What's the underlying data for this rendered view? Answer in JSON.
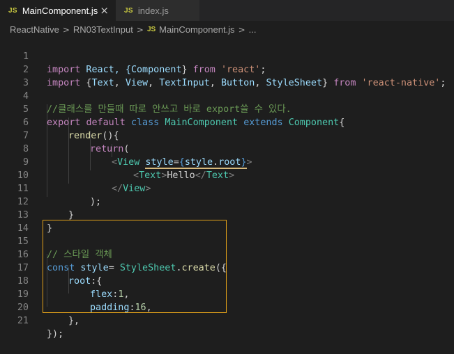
{
  "tabs": [
    {
      "label": "MainComponent.js",
      "badge": "JS",
      "close": "×"
    },
    {
      "label": "index.js",
      "badge": "JS"
    }
  ],
  "breadcrumb": {
    "items": [
      "ReactNative",
      "RN03TextInput",
      "MainComponent.js",
      "..."
    ],
    "js_badge": "JS"
  },
  "line_numbers": [
    "1",
    "2",
    "3",
    "4",
    "5",
    "6",
    "7",
    "8",
    "9",
    "10",
    "11",
    "12",
    "13",
    "14",
    "15",
    "16",
    "17",
    "18",
    "19",
    "20",
    "21"
  ],
  "code": {
    "l1": [
      "import",
      " React, {",
      "Component",
      "} ",
      "from",
      " ",
      "'react'",
      ";"
    ],
    "l2": [
      "import",
      " {",
      "Text",
      ", ",
      "View",
      ", ",
      "TextInput",
      ", ",
      "Button",
      ", ",
      "StyleSheet",
      "} ",
      "from",
      " ",
      "'react-native'",
      ";"
    ],
    "l4": "//클래스를 만들때 따로 안쓰고 바로 export쓸 수 있다.",
    "l5": [
      "export",
      " ",
      "default",
      " ",
      "class",
      " ",
      "MainComponent",
      " ",
      "extends",
      " ",
      "Component",
      "{"
    ],
    "l6": [
      "render",
      "(){"
    ],
    "l7": [
      "return",
      "("
    ],
    "l8": [
      "<",
      "View",
      " ",
      "style",
      "=",
      "{",
      "style",
      ".",
      "root",
      "}",
      ">"
    ],
    "l9": [
      "<",
      "Text",
      ">",
      "Hello",
      "</",
      "Text",
      ">"
    ],
    "l10": [
      "</",
      "View",
      ">"
    ],
    "l11": ");",
    "l12": "}",
    "l13": "}",
    "l15": "// 스타일 객체",
    "l16": [
      "const",
      " ",
      "style",
      "= ",
      "StyleSheet",
      ".",
      "create",
      "({"
    ],
    "l17": [
      "root",
      ":{"
    ],
    "l18": [
      "flex",
      ":",
      "1",
      ","
    ],
    "l19": [
      "padding",
      ":",
      "16",
      ","
    ],
    "l20": "},",
    "l21": "});"
  }
}
